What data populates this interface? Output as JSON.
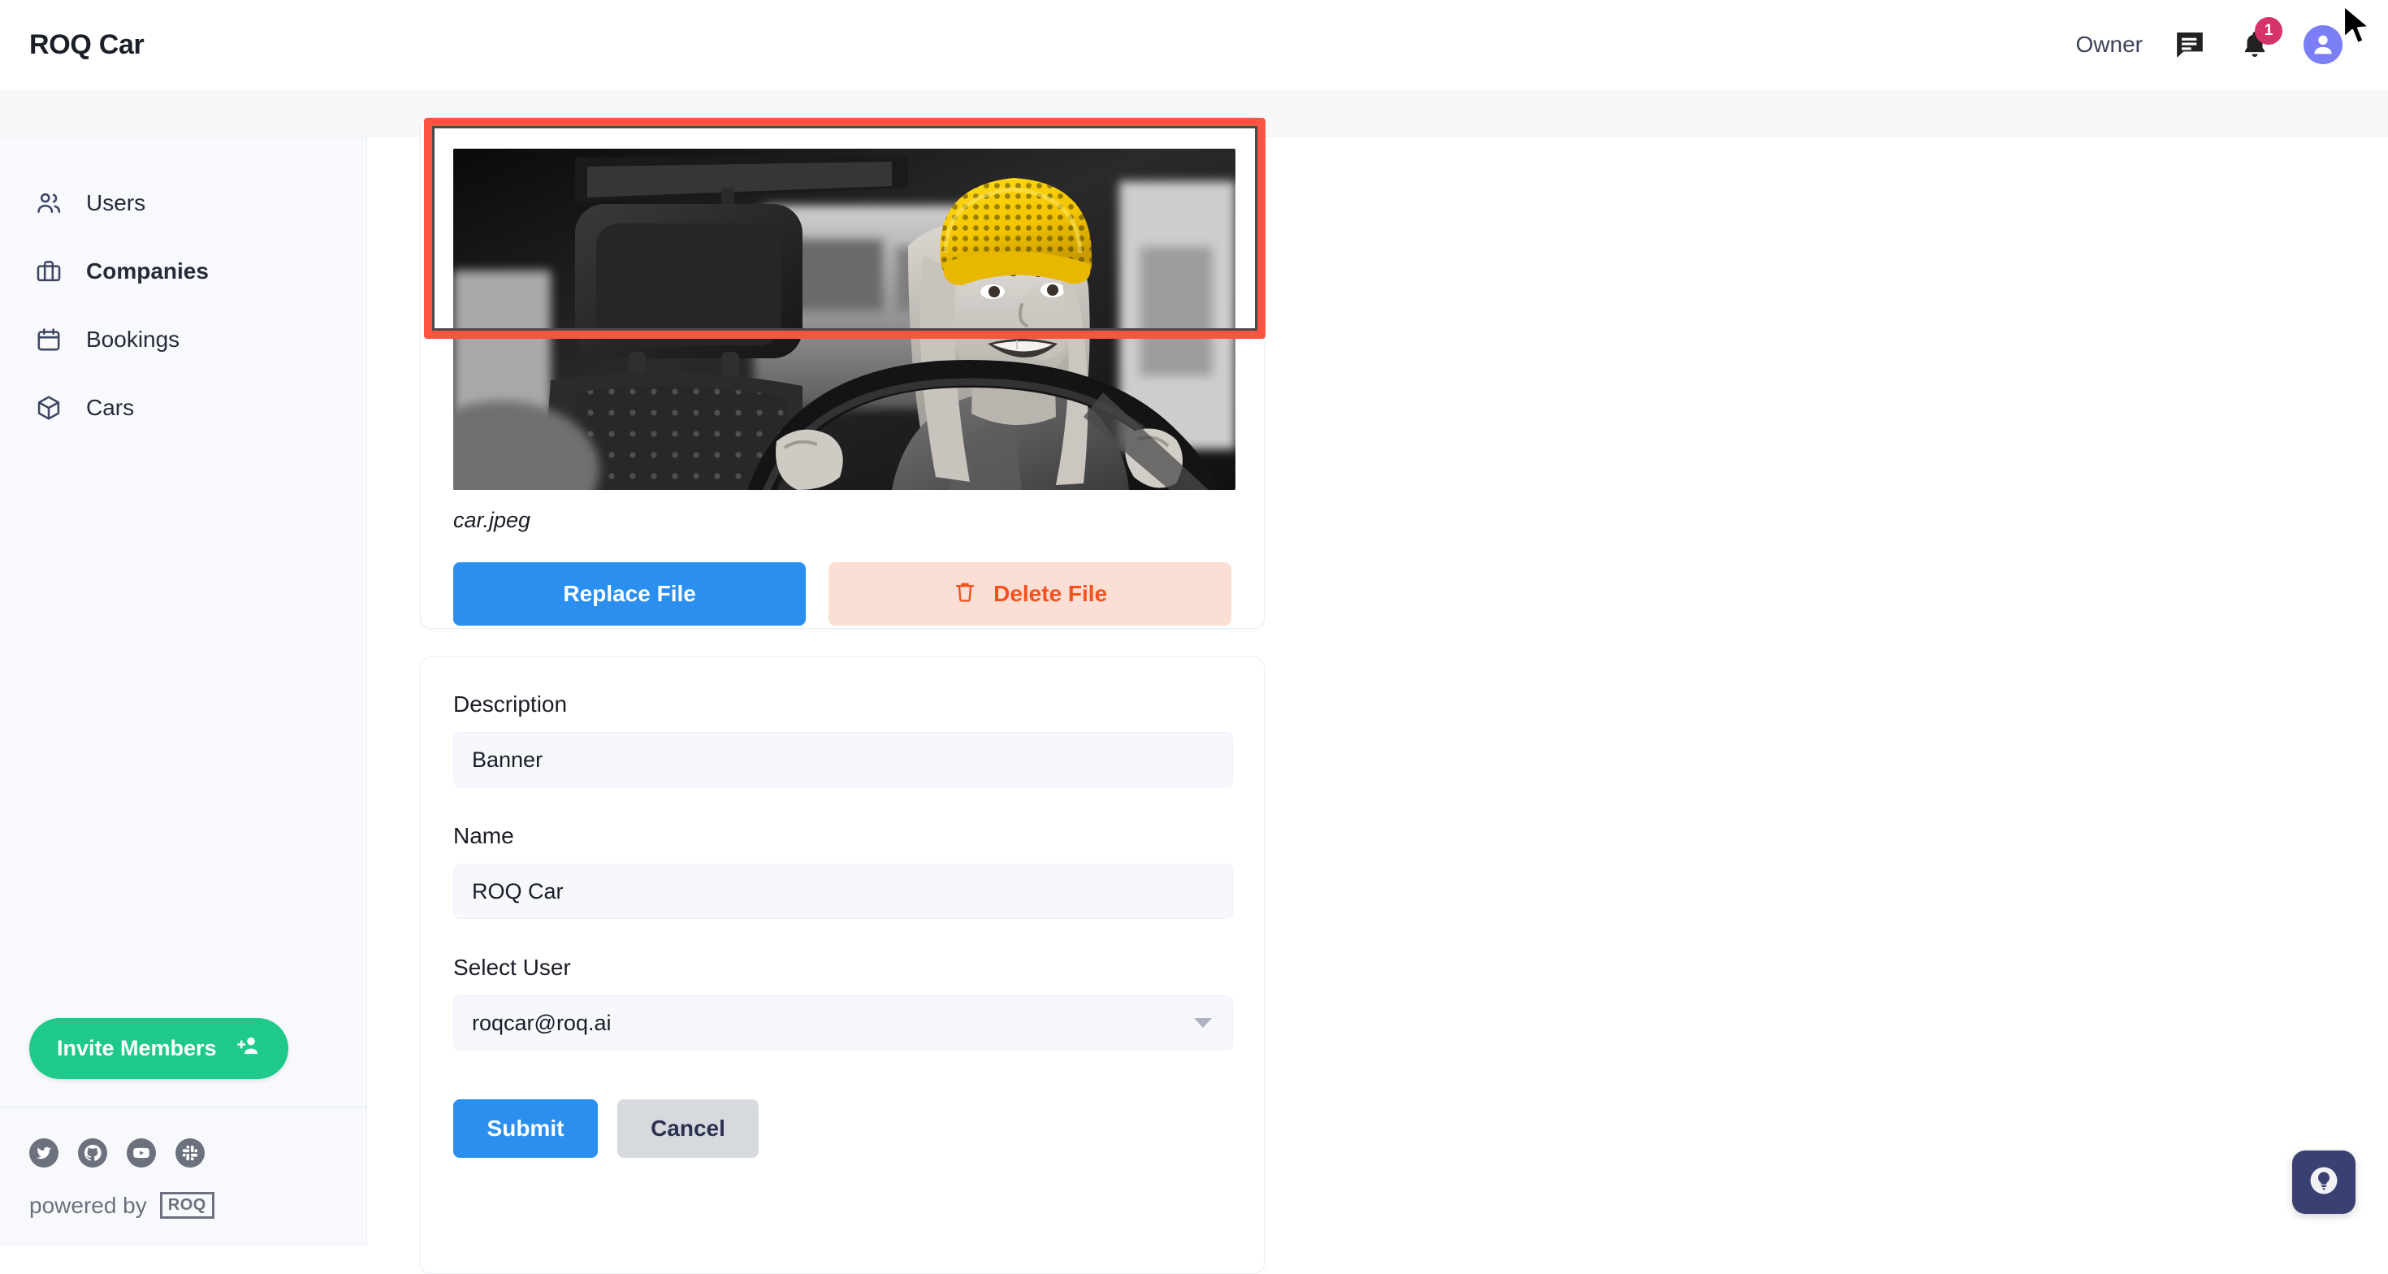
{
  "header": {
    "brand": "ROQ Car",
    "owner_label": "Owner",
    "chat_icon": "chat-bubble-icon",
    "bell_icon": "bell-icon",
    "notification_count": "1",
    "avatar_icon": "user-avatar-icon"
  },
  "sidebar": {
    "items": [
      {
        "label": "Users",
        "icon": "users-icon",
        "active": false
      },
      {
        "label": "Companies",
        "icon": "briefcase-icon",
        "active": true
      },
      {
        "label": "Bookings",
        "icon": "calendar-icon",
        "active": false
      },
      {
        "label": "Cars",
        "icon": "box-icon",
        "active": false
      }
    ],
    "invite_button": {
      "label": "Invite Members",
      "icon": "person-add-icon"
    },
    "social": [
      {
        "name": "twitter-icon"
      },
      {
        "name": "github-icon"
      },
      {
        "name": "youtube-icon"
      },
      {
        "name": "slack-icon"
      }
    ],
    "powered_by": "powered by",
    "powered_logo": "ROQ"
  },
  "upload_card": {
    "image_alt": "woman-driving-car-photo",
    "filename": "car.jpeg",
    "replace_button": "Replace File",
    "delete_button": "Delete File",
    "delete_icon": "trash-icon"
  },
  "form": {
    "description": {
      "label": "Description",
      "value": "Banner"
    },
    "name": {
      "label": "Name",
      "value": "ROQ Car"
    },
    "select_user": {
      "label": "Select User",
      "value": "roqcar@roq.ai",
      "options": [
        "roqcar@roq.ai"
      ],
      "chevron_icon": "chevron-down-icon"
    },
    "submit_button": "Submit",
    "cancel_button": "Cancel"
  },
  "help": {
    "icon": "lightbulb-icon"
  },
  "colors": {
    "accent_blue": "#2a8fee",
    "danger_red": "#f4511e",
    "highlight_red": "#fb5440",
    "green": "#1ec98a",
    "badge": "#d6336c",
    "avatar": "#7b7ef5",
    "help_navy": "#3a4071"
  }
}
